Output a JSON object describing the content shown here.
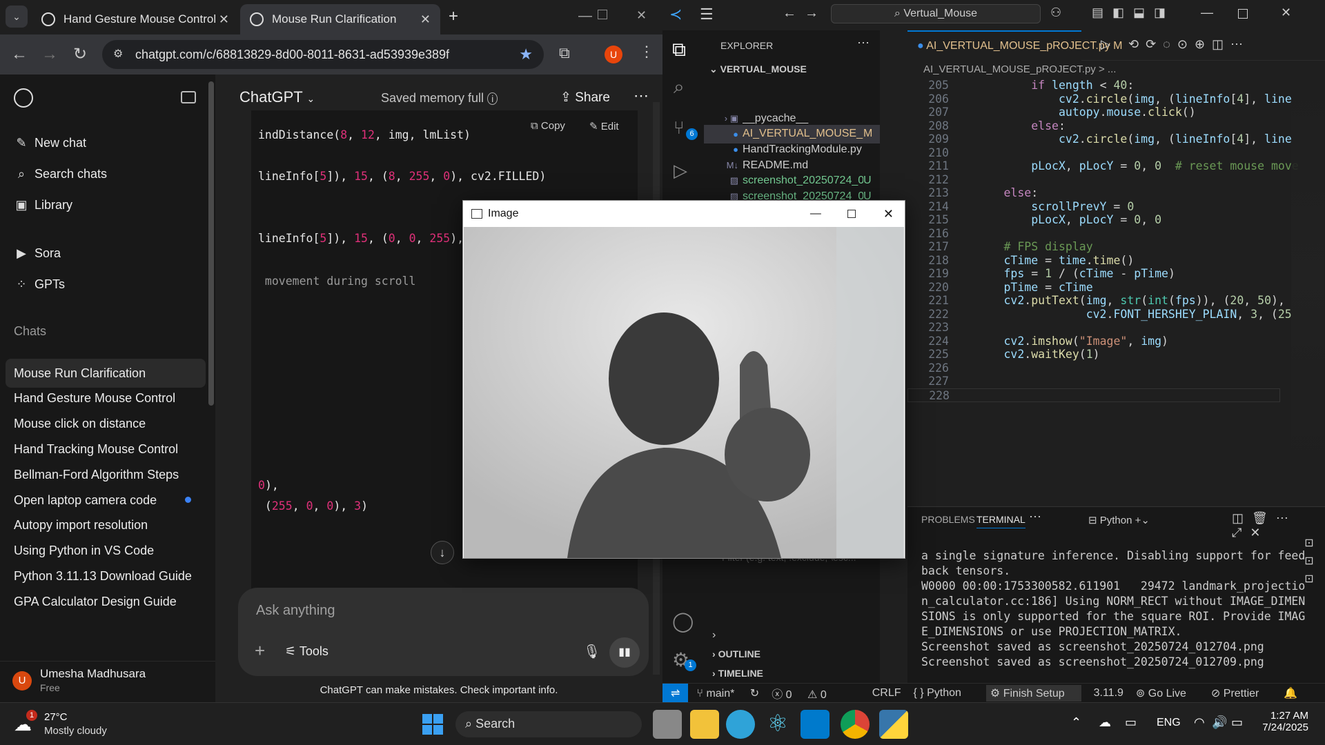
{
  "chrome": {
    "tabs": [
      {
        "title": "Hand Gesture Mouse Control"
      },
      {
        "title": "Mouse Run Clarification"
      }
    ],
    "url": "chatgpt.com/c/68813829-8d00-8011-8631-ad53939e389f",
    "profile_letter": "U"
  },
  "chatgpt": {
    "model": "ChatGPT",
    "memory": "Saved memory full",
    "share": "Share",
    "nav": [
      {
        "label": "New chat",
        "icon": "edit-icon"
      },
      {
        "label": "Search chats",
        "icon": "search-icon"
      },
      {
        "label": "Library",
        "icon": "library-icon"
      }
    ],
    "nav2": [
      {
        "label": "Sora",
        "icon": "play-icon"
      },
      {
        "label": "GPTs",
        "icon": "grid-icon"
      }
    ],
    "chats_heading": "Chats",
    "chats": [
      "Mouse Run Clarification",
      "Hand Gesture Mouse Control",
      "Mouse click on distance",
      "Hand Tracking Mouse Control",
      "Bellman-Ford Algorithm Steps",
      "Open laptop camera code",
      "Autopy import resolution",
      "Using Python in VS Code",
      "Python 3.11.13 Download Guide",
      "GPA Calculator Design Guide"
    ],
    "user": {
      "name": "Umesha Madhusara",
      "plan": "Free",
      "initial": "U"
    },
    "copy": "Copy",
    "edit": "Edit",
    "code_lines": [
      "indDistance(8, 12, img, lmList)",
      "lineInfo[5]), 15, (8, 255, 0), cv2.FILLED)",
      "lineInfo[5]), 15, (0, 0, 255), c",
      " movement during scroll",
      "0),",
      " (255, 0, 0), 3)"
    ],
    "composer_placeholder": "Ask anything",
    "tools": "Tools",
    "disclaimer": "ChatGPT can make mistakes. Check important info."
  },
  "image_window": {
    "title": "Image"
  },
  "vscode": {
    "search": "Vertual_Mouse",
    "explorer_title": "EXPLORER",
    "folder": "VERTUAL_MOUSE",
    "files": [
      {
        "name": "__pycache__",
        "badge": ""
      },
      {
        "name": "AI_VERTUAL_MOUSE_p...",
        "badge": "M"
      },
      {
        "name": "HandTrackingModule.py",
        "badge": ""
      },
      {
        "name": "README.md",
        "badge": ""
      },
      {
        "name": "screenshot_20250724_0...",
        "badge": "U"
      },
      {
        "name": "screenshot_20250724_0...",
        "badge": "U"
      }
    ],
    "filter_placeholder": "Filter (e.g. text, !exclude, \\esc...",
    "outline": "OUTLINE",
    "timeline": "TIMELINE",
    "tab": "AI_VERTUAL_MOUSE_pROJECT.py",
    "tab_badge": "M",
    "breadcrumb": "AI_VERTUAL_MOUSE_pROJECT.py > ...",
    "panel_tabs": [
      "PROBLEMS",
      "TERMINAL"
    ],
    "terminal_profile": "Python",
    "terminal_lines": [
      "a single signature inference. Disabling support for feed",
      "back tensors.",
      "W0000 00:00:1753300582.611901   29472 landmark_projectio",
      "n_calculator.cc:186] Using NORM_RECT without IMAGE_DIMEN",
      "SIONS is only supported for the square ROI. Provide IMAG",
      "E_DIMENSIONS or use PROJECTION_MATRIX.",
      "Screenshot saved as screenshot_20250724_012704.png",
      "Screenshot saved as screenshot_20250724_012709.png"
    ],
    "status": {
      "branch": "main*",
      "errors": "0",
      "warnings": "0",
      "eol": "CRLF",
      "lang": "Python",
      "setup": "Finish Setup",
      "version": "3.11.9",
      "golive": "Go Live",
      "prettier": "Prettier"
    },
    "scm_badge": "6",
    "settings_badge": "1"
  },
  "taskbar": {
    "temp": "27°C",
    "weather": "Mostly cloudy",
    "weather_badge": "1",
    "search": "Search",
    "lang": "ENG",
    "time": "1:27 AM",
    "date": "7/24/2025"
  }
}
